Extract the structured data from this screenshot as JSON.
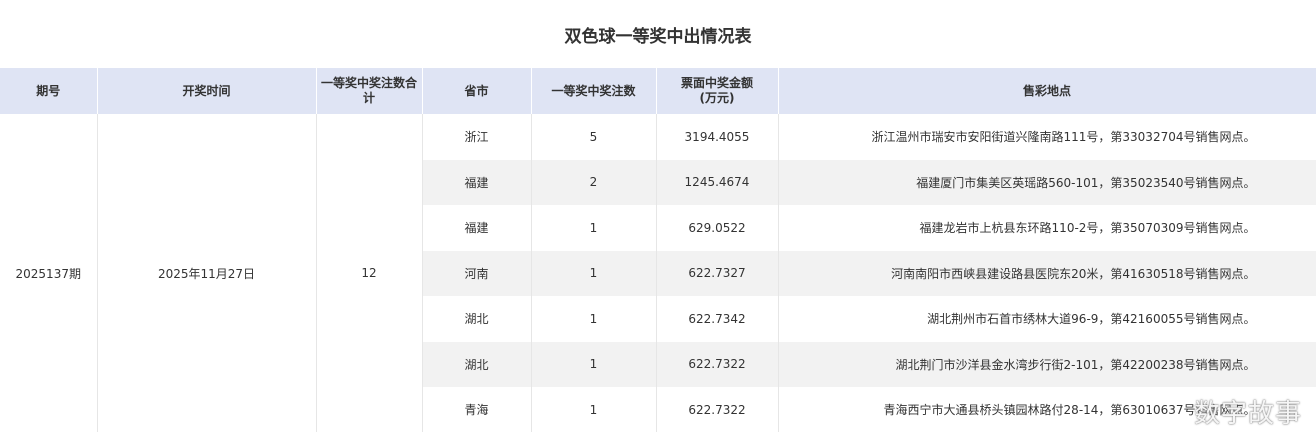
{
  "title": "双色球一等奖中出情况表",
  "headers": [
    "期号",
    "开奖时间",
    "一等奖中奖注数合计",
    "省市",
    "一等奖中奖注数",
    "票面中奖金额\n(万元)",
    "售彩地点"
  ],
  "summary": {
    "issue": "2025137期",
    "draw_date": "2025年11月27日",
    "total_winners": "12"
  },
  "rows": [
    {
      "province": "浙江",
      "count": "5",
      "amount": "3194.4055",
      "location": "浙江温州市瑞安市安阳街道兴隆南路111号，第33032704号销售网点。"
    },
    {
      "province": "福建",
      "count": "2",
      "amount": "1245.4674",
      "location": "福建厦门市集美区英瑶路560-101，第35023540号销售网点。"
    },
    {
      "province": "福建",
      "count": "1",
      "amount": "629.0522",
      "location": "福建龙岩市上杭县东环路110-2号，第35070309号销售网点。"
    },
    {
      "province": "河南",
      "count": "1",
      "amount": "622.7327",
      "location": "河南南阳市西峡县建设路县医院东20米，第41630518号销售网点。"
    },
    {
      "province": "湖北",
      "count": "1",
      "amount": "622.7342",
      "location": "湖北荆州市石首市绣林大道96-9，第42160055号销售网点。"
    },
    {
      "province": "湖北",
      "count": "1",
      "amount": "622.7322",
      "location": "湖北荆门市沙洋县金水湾步行街2-101，第42200238号销售网点。"
    },
    {
      "province": "青海",
      "count": "1",
      "amount": "622.7322",
      "location": "青海西宁市大通县桥头镇园林路付28-14，第63010637号销售网点。"
    }
  ],
  "watermark": "数字故事"
}
